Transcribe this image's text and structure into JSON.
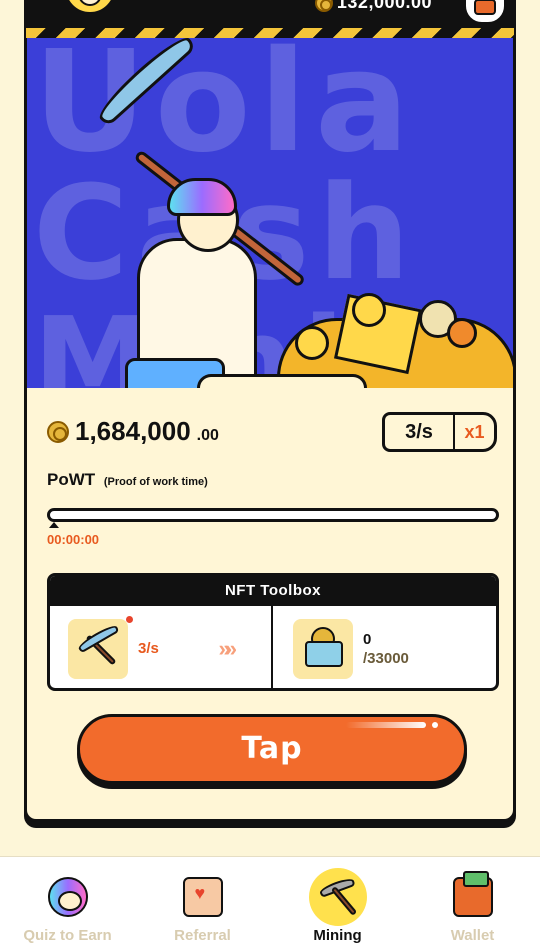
{
  "header": {
    "balance": "132,000.00",
    "icons": {
      "avatar": "user-avatar",
      "wallet": "wallet-icon",
      "coin": "coin-icon"
    }
  },
  "mining": {
    "balance_main": "1,684,000",
    "balance_decimal": ".00",
    "rate": "3/s",
    "multiplier": "x1",
    "powt_title": "PoWT",
    "powt_subtitle": "(Proof of work time)",
    "timer": "00:00:00",
    "progress_percent": 0
  },
  "toolbox": {
    "title": "NFT Toolbox",
    "pickaxe_rate": "3/s",
    "chevrons": "»»",
    "cart_count": "0",
    "cart_total": "/33000"
  },
  "tap_button": {
    "label": "Tap"
  },
  "nav": {
    "items": [
      {
        "label": "Quiz to Earn",
        "icon": "quiz-avatar-icon",
        "active": false
      },
      {
        "label": "Referral",
        "icon": "referral-envelope-icon",
        "active": false
      },
      {
        "label": "Mining",
        "icon": "pickaxe-icon",
        "active": true
      },
      {
        "label": "Wallet",
        "icon": "wallet-icon",
        "active": false
      }
    ]
  },
  "colors": {
    "accent": "#f26b2c",
    "background": "#fdf6d8",
    "scene": "#3b3fd8",
    "mining_highlight": "#ffe14d"
  }
}
